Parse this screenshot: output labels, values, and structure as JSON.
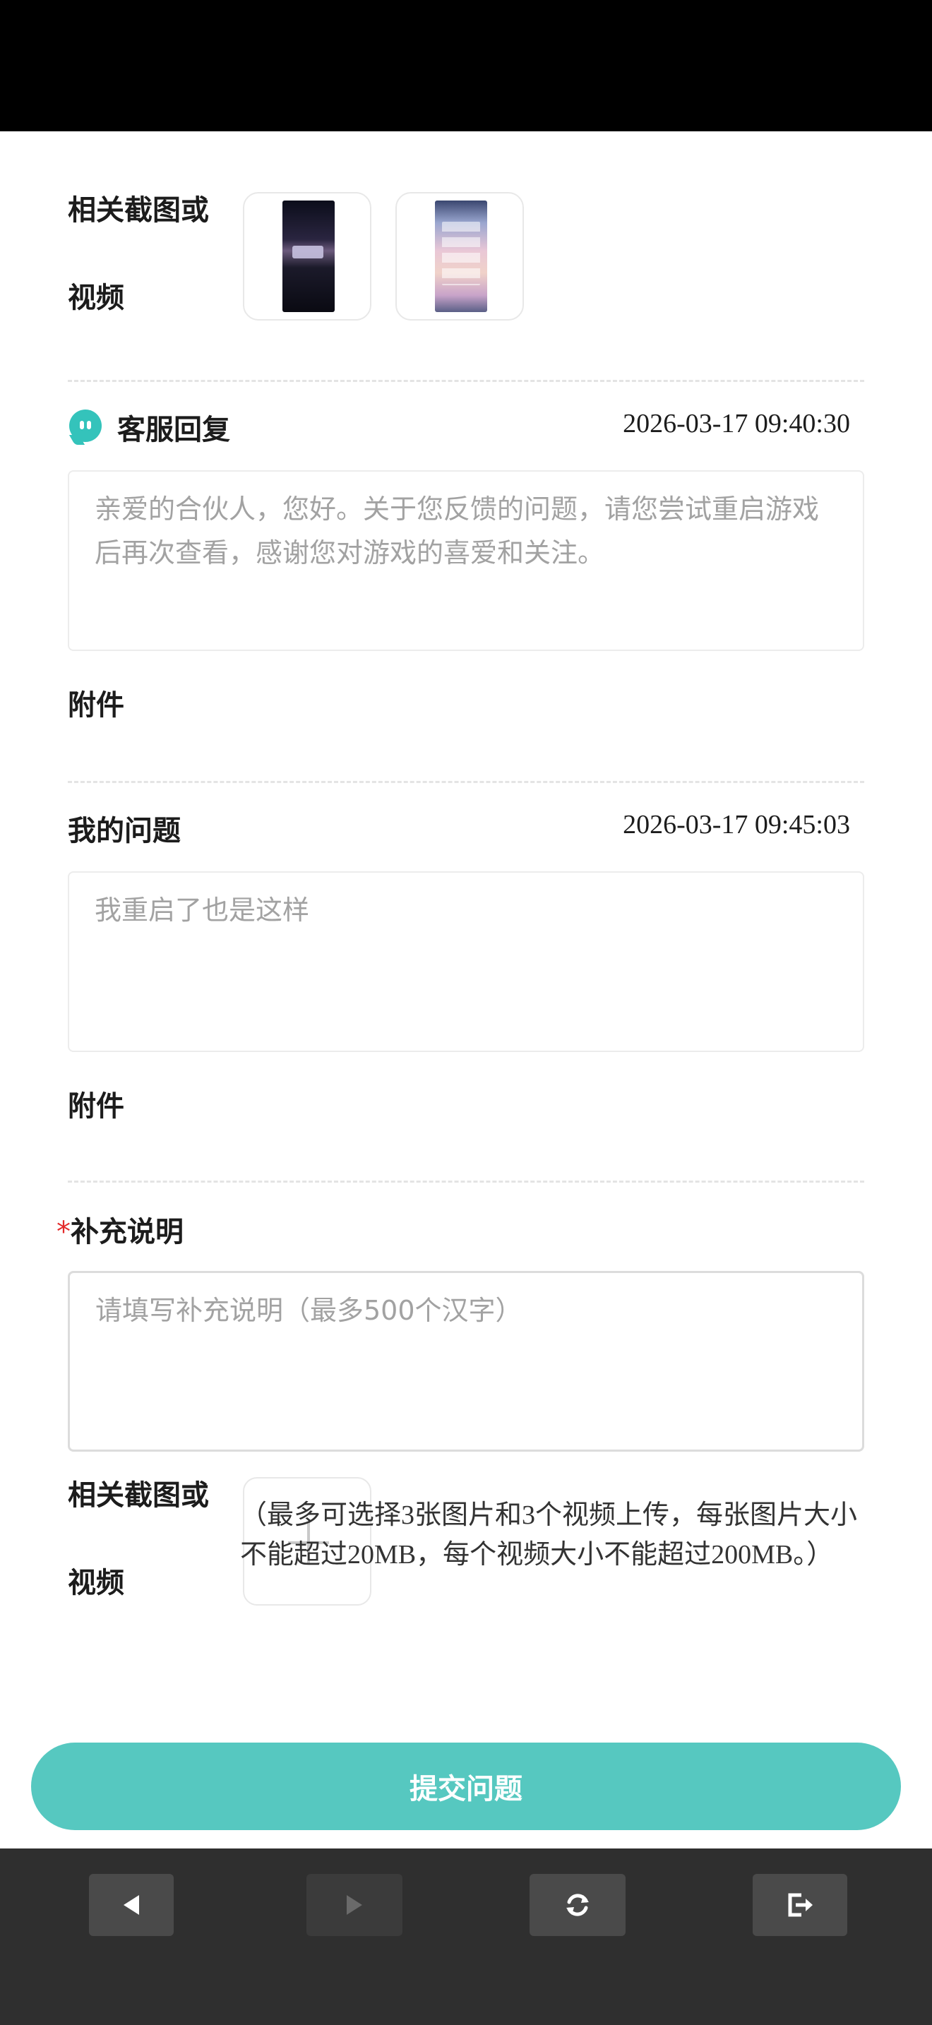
{
  "feedback": {
    "attachments_label_line1": "相关截图或",
    "attachments_label_line2": "视频"
  },
  "cs_reply": {
    "icon": "chat-bubble-icon",
    "title": "客服回复",
    "datetime": "2026-03-17 09:40:30",
    "content": "亲爱的合伙人，您好。关于您反馈的问题，请您尝试重启游戏后再次查看，感谢您对游戏的喜爱和关注。",
    "attachment_label": "附件"
  },
  "my_question": {
    "title": "我的问题",
    "datetime": "2026-03-17 09:45:03",
    "content": "我重启了也是这样",
    "attachment_label": "附件"
  },
  "supplement": {
    "required_mark": "*",
    "title": "补充说明",
    "placeholder": "请填写补充说明（最多500个汉字）",
    "upload_label_line1": "相关截图或",
    "upload_label_line2": "视频",
    "upload_hint": "（最多可选择3张图片和3个视频上传，每张图片大小不能超过20MB，每个视频大小不能超过200MB。）"
  },
  "submit_label": "提交问题",
  "bottom_nav": {
    "back_icon": "back-arrow-icon",
    "forward_icon": "forward-arrow-icon",
    "refresh_icon": "refresh-icon",
    "exit_icon": "exit-icon"
  },
  "colors": {
    "accent": "#56c8c0",
    "cs_icon": "#34c3bb",
    "required": "#e32a2a",
    "bottom_bar": "#2f2f2f"
  }
}
